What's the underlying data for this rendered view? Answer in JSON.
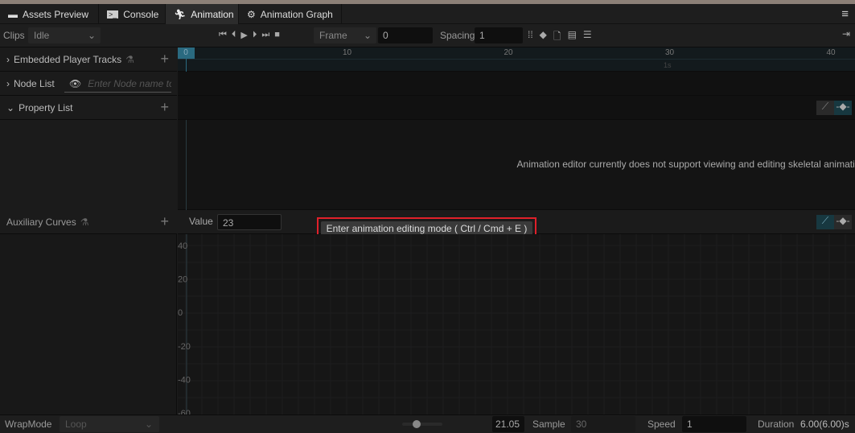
{
  "tabs": [
    {
      "label": "Assets Preview",
      "icon": "folder-icon"
    },
    {
      "label": "Console",
      "icon": "terminal-icon"
    },
    {
      "label": "Animation",
      "icon": "running-man-icon",
      "active": true
    },
    {
      "label": "Animation Graph",
      "icon": "graph-icon"
    }
  ],
  "toolbar": {
    "clips_label": "Clips",
    "clip_value": "Idle",
    "frame_mode": "Frame",
    "frame_value": "0",
    "spacing_label": "Spacing",
    "spacing_value": "1"
  },
  "timeline": {
    "ticks": [
      "0",
      "10",
      "20",
      "30",
      "40"
    ],
    "second_marker": "1s"
  },
  "left": {
    "embedded": "Embedded Player Tracks",
    "node_list": "Node List",
    "node_placeholder": "Enter Node name to search",
    "property_list": "Property List",
    "aux": "Auxiliary Curves"
  },
  "message": "Animation editor currently does not support viewing and editing skeletal animation.",
  "aux": {
    "value_label": "Value",
    "value": "23",
    "enter_mode": "Enter animation editing mode ( Ctrl / Cmd + E )",
    "y_ticks": [
      "40",
      "20",
      "0",
      "-20",
      "-40",
      "-60"
    ]
  },
  "bottom": {
    "wrap_label": "WrapMode",
    "wrap_value": "Loop",
    "zoom_value": "21.05",
    "sample_label": "Sample",
    "sample_value": "30",
    "speed_label": "Speed",
    "speed_value": "1",
    "duration_label": "Duration",
    "duration_value": "6.00(6.00)s",
    "zoom_slider_fraction": 0.25
  },
  "colors": {
    "accent": "#2a6a80",
    "highlight": "#e0202a"
  }
}
